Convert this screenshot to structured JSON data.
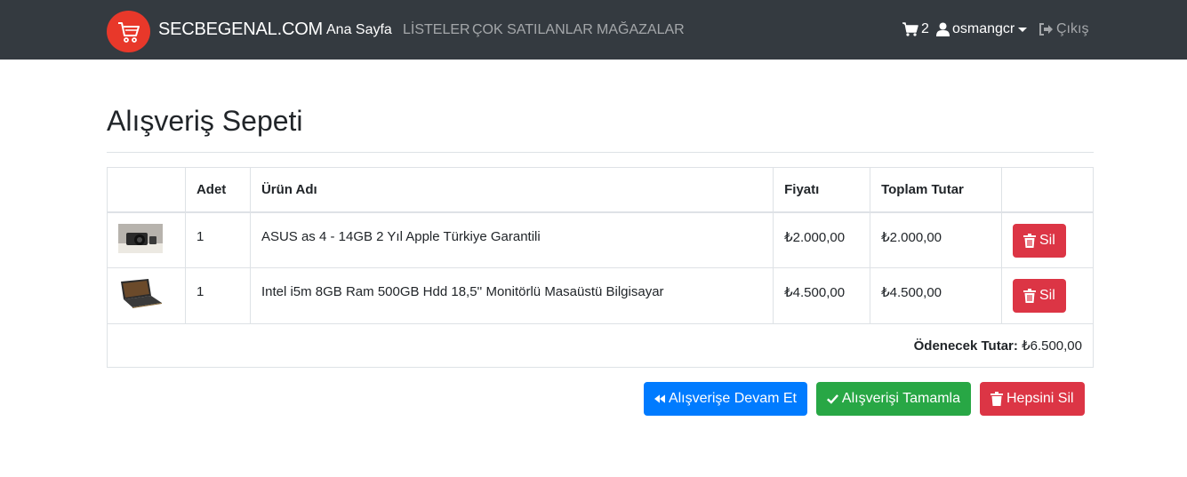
{
  "navbar": {
    "brand": "SECBEGENAL.COM",
    "links": [
      {
        "label": "Ana Sayfa",
        "active": true
      },
      {
        "label": "LİSTELER",
        "active": false
      },
      {
        "label": "ÇOK SATILANLAR",
        "active": false
      },
      {
        "label": "MAĞAZALAR",
        "active": false
      }
    ],
    "cart_count": "2",
    "username": "osmangcr",
    "logout": "Çıkış",
    "icons": {
      "logo": "shopping-cart-icon",
      "cart": "shopping-cart-icon",
      "user": "user-icon",
      "logout": "sign-out-icon"
    }
  },
  "page": {
    "title": "Alışveriş Sepeti"
  },
  "table": {
    "headers": [
      "",
      "Adet",
      "Ürün Adı",
      "Fiyatı",
      "Toplam Tutar",
      ""
    ],
    "rows": [
      {
        "image": "camera-thumbnail",
        "qty": "1",
        "name": "ASUS as 4 - 14GB 2 Yıl Apple Türkiye Garantili",
        "price": "₺2.000,00",
        "total": "₺2.000,00",
        "delete_label": "Sil"
      },
      {
        "image": "laptop-thumbnail",
        "qty": "1",
        "name": "Intel i5m 8GB Ram 500GB Hdd 18,5'' Monitörlü Masaüstü Bilgisayar",
        "price": "₺4.500,00",
        "total": "₺4.500,00",
        "delete_label": "Sil"
      }
    ],
    "grand_total_label": "Ödenecek Tutar:",
    "grand_total_value": "₺6.500,00"
  },
  "actions": {
    "continue_label": "Alışverişe Devam Et",
    "complete_label": "Alışverişi Tamamla",
    "clear_label": "Hepsini Sil"
  },
  "colors": {
    "navbar_bg": "#343a40",
    "logo_bg": "#e8382a",
    "primary": "#007bff",
    "success": "#28a745",
    "danger": "#dc3545"
  }
}
